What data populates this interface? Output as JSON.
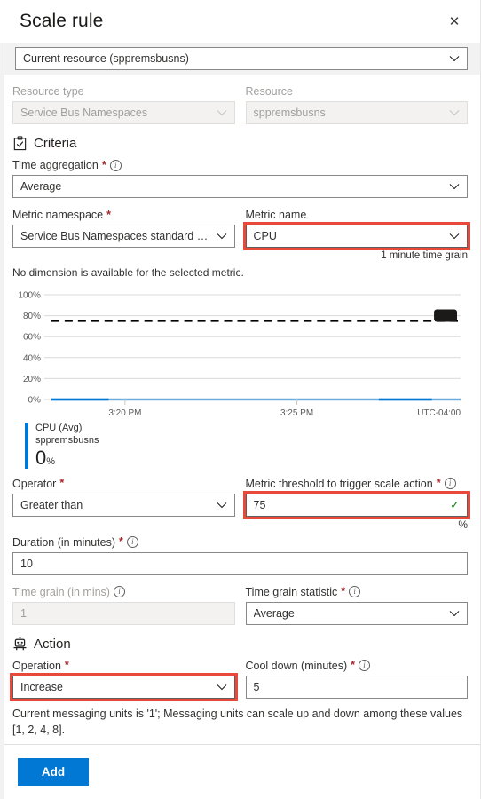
{
  "header": {
    "title": "Scale rule",
    "close_label": "✕"
  },
  "scope": {
    "value": "Current resource (sppremsbusns)"
  },
  "resource": {
    "type_label": "Resource type",
    "type_value": "Service Bus Namespaces",
    "name_label": "Resource",
    "name_value": "sppremsbusns"
  },
  "criteria": {
    "section_title": "Criteria",
    "time_aggregation_label": "Time aggregation",
    "time_aggregation_value": "Average",
    "metric_namespace_label": "Metric namespace",
    "metric_namespace_value": "Service Bus Namespaces standard me...",
    "metric_name_label": "Metric name",
    "metric_name_value": "CPU",
    "time_grain_hint": "1 minute time grain",
    "dimension_note": "No dimension is available for the selected metric.",
    "operator_label": "Operator",
    "operator_value": "Greater than",
    "threshold_label": "Metric threshold to trigger scale action",
    "threshold_value": "75",
    "threshold_unit": "%",
    "duration_label": "Duration (in minutes)",
    "duration_value": "10",
    "time_grain_label": "Time grain (in mins)",
    "time_grain_value": "1",
    "time_grain_stat_label": "Time grain statistic",
    "time_grain_stat_value": "Average"
  },
  "action": {
    "section_title": "Action",
    "operation_label": "Operation",
    "operation_value": "Increase",
    "cooldown_label": "Cool down (minutes)",
    "cooldown_value": "5",
    "note": "Current messaging units is '1'; Messaging units can scale up and down among these values [1, 2, 4, 8]."
  },
  "footer": {
    "add_label": "Add"
  },
  "colors": {
    "accent": "#0078d4",
    "highlight": "#e8493a",
    "required": "#a4262c",
    "valid": "#107c10",
    "series": "#0078d4"
  },
  "chart_data": {
    "type": "line",
    "title": "",
    "xlabel": "",
    "ylabel": "",
    "ylim": [
      0,
      100
    ],
    "ytick_labels": [
      "0%",
      "20%",
      "40%",
      "60%",
      "80%",
      "100%"
    ],
    "ytick_values": [
      0,
      20,
      40,
      60,
      80,
      100
    ],
    "xtick_labels": [
      "3:20 PM",
      "3:25 PM"
    ],
    "xtick_positions": [
      0.18,
      0.6
    ],
    "timezone_label": "UTC-04:00",
    "grid": true,
    "legend_position": "bottom-left",
    "threshold_line": {
      "value": 75,
      "style": "dashed",
      "color": "#000000",
      "badge": true
    },
    "series": [
      {
        "name": "CPU (Avg)",
        "resource": "sppremsbusns",
        "unit": "%",
        "current_value": "0",
        "color": "#0078d4",
        "x": [
          0.0,
          0.05,
          0.1,
          0.14,
          0.2,
          0.3,
          0.4,
          0.5,
          0.6,
          0.7,
          0.78,
          0.84,
          0.9,
          0.96,
          1.0
        ],
        "values": [
          0,
          0,
          0,
          0,
          0,
          0,
          0,
          0,
          0,
          0,
          0,
          0,
          0,
          0,
          0
        ]
      }
    ]
  }
}
